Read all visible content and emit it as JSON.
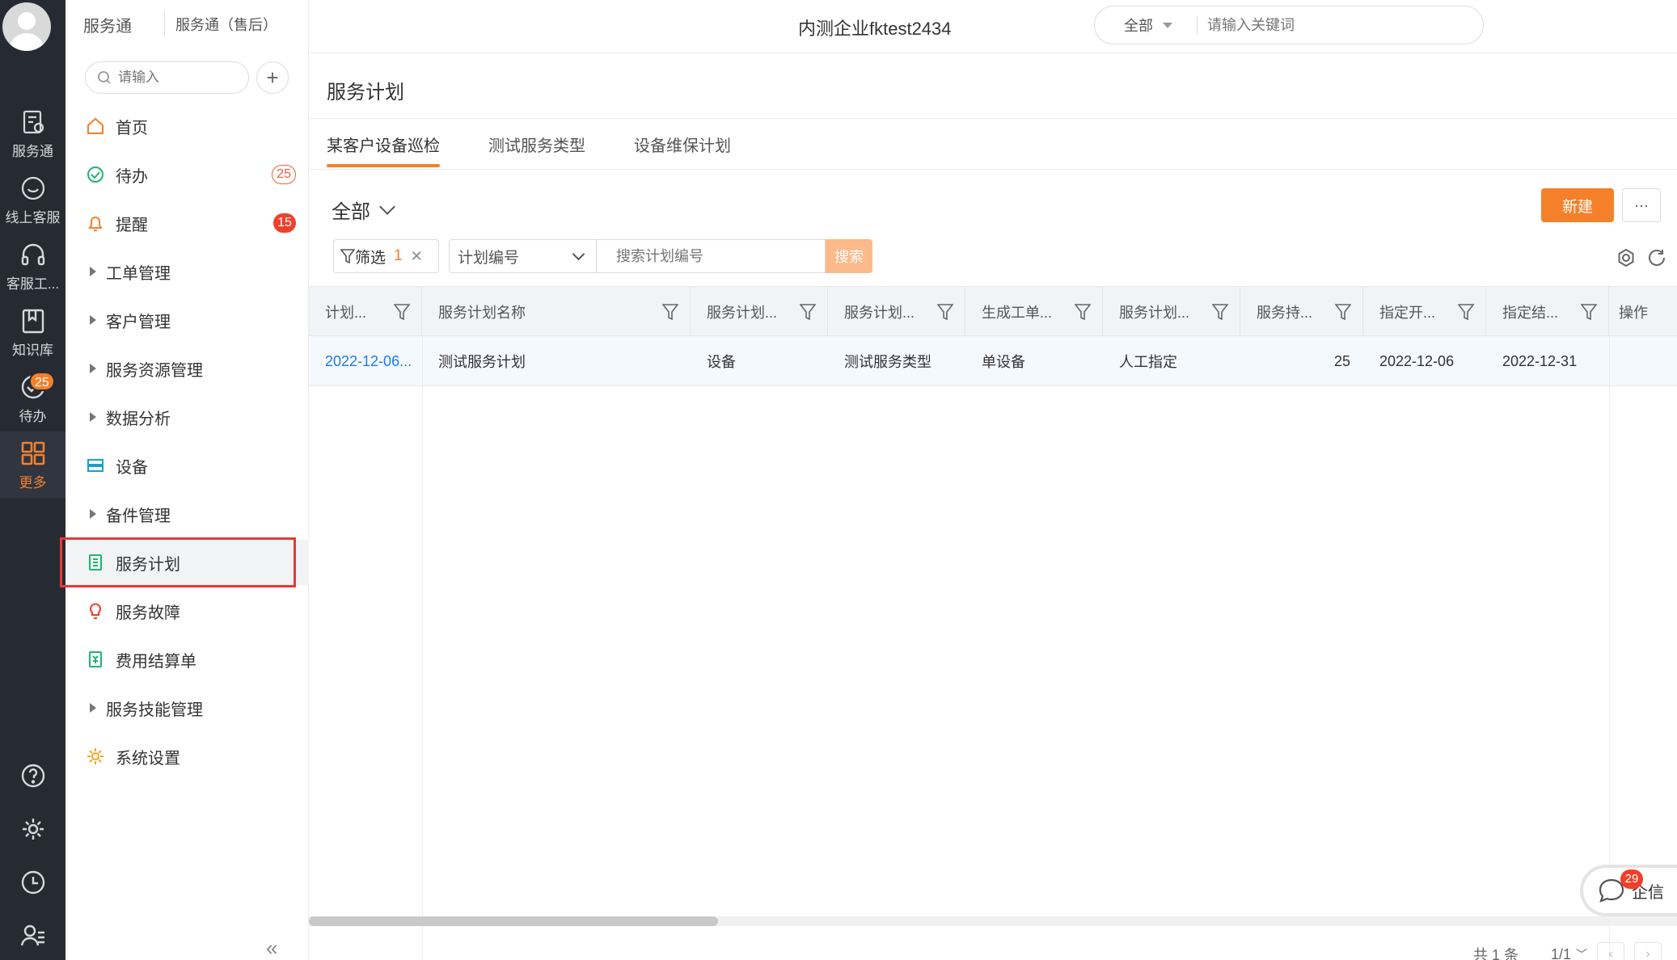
{
  "rail": {
    "items": [
      {
        "label": "服务通",
        "icon": "service-icon"
      },
      {
        "label": "线上客服",
        "icon": "chat-icon"
      },
      {
        "label": "客服工...",
        "icon": "headset-icon"
      },
      {
        "label": "知识库",
        "icon": "book-icon"
      },
      {
        "label": "待办",
        "icon": "check-circle-icon",
        "badge": "25"
      },
      {
        "label": "更多",
        "icon": "grid-icon",
        "active": true
      }
    ],
    "bottom": [
      "help-icon",
      "settings-icon",
      "clock-icon",
      "user-list-icon"
    ]
  },
  "nav": {
    "brand": "服务通",
    "brand_sub": "服务通（售后）",
    "search_placeholder": "请输入",
    "items": [
      {
        "label": "首页",
        "icon": "home-icon"
      },
      {
        "label": "待办",
        "icon": "check-circle-icon",
        "badge": "25",
        "badge_style": "outline"
      },
      {
        "label": "提醒",
        "icon": "bell-icon",
        "badge": "15",
        "badge_style": "solid"
      },
      {
        "label": "工单管理",
        "expandable": true
      },
      {
        "label": "客户管理",
        "expandable": true
      },
      {
        "label": "服务资源管理",
        "expandable": true
      },
      {
        "label": "数据分析",
        "expandable": true
      },
      {
        "label": "设备",
        "icon": "device-icon"
      },
      {
        "label": "备件管理",
        "expandable": true
      },
      {
        "label": "服务计划",
        "icon": "plan-icon",
        "selected": true
      },
      {
        "label": "服务故障",
        "icon": "bulb-icon"
      },
      {
        "label": "费用结算单",
        "icon": "invoice-icon"
      },
      {
        "label": "服务技能管理",
        "expandable": true
      },
      {
        "label": "系统设置",
        "icon": "gear-icon"
      }
    ]
  },
  "header": {
    "company": "内测企业fktest2434",
    "scope": "全部",
    "search_placeholder": "请输入关键词"
  },
  "main": {
    "title": "服务计划",
    "tabs": [
      {
        "label": "某客户设备巡检",
        "active": true
      },
      {
        "label": "测试服务类型"
      },
      {
        "label": "设备维保计划"
      }
    ],
    "view": "全部",
    "new_label": "新建",
    "more_label": "···",
    "filter_label": "筛选",
    "filter_count": "1",
    "field_select": "计划编号",
    "kw_placeholder": "搜索计划编号",
    "search_label": "搜索"
  },
  "table": {
    "columns": [
      "计划...",
      "服务计划名称",
      "服务计划...",
      "服务计划...",
      "生成工单...",
      "服务计划...",
      "服务持...",
      "指定开...",
      "指定结...",
      "操作"
    ],
    "rows": [
      [
        "2022-12-06...",
        "测试服务计划",
        "设备",
        "测试服务类型",
        "单设备",
        "人工指定",
        "25",
        "2022-12-06",
        "2022-12-31",
        ""
      ]
    ]
  },
  "footer": {
    "total": "共 1 条",
    "page": "1/1"
  },
  "qx": {
    "label": "企信",
    "badge": "29"
  },
  "colors": {
    "accent": "#f5802a",
    "rail_bg": "#262a33",
    "link": "#1e7be8"
  }
}
